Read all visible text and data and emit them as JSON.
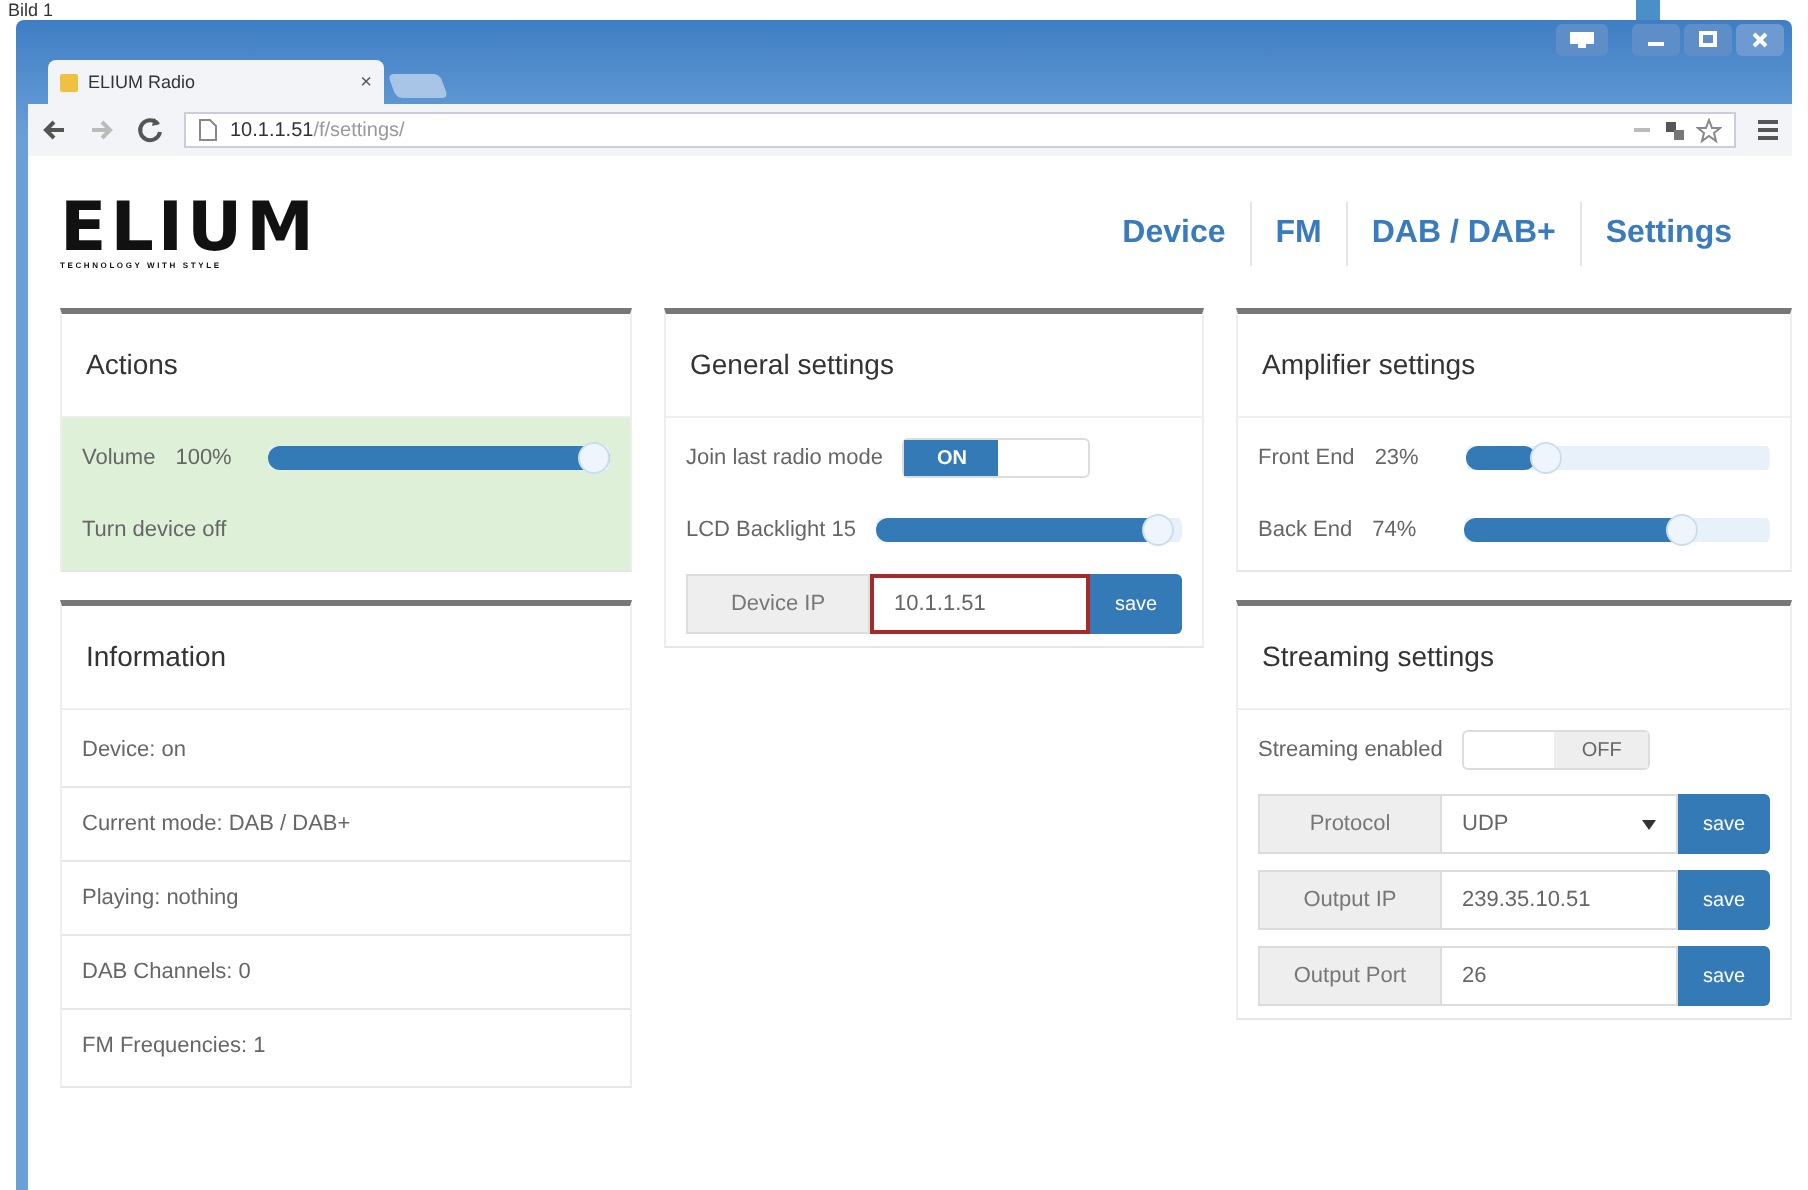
{
  "caption": "Bild 1",
  "browser": {
    "tab_title": "ELIUM Radio",
    "tab_close": "×",
    "url_host": "10.1.1.51",
    "url_path": "/f/settings/"
  },
  "header": {
    "logo": "ELIUM",
    "tagline": "TECHNOLOGY WITH STYLE",
    "nav": [
      "Device",
      "FM",
      "DAB / DAB+",
      "Settings"
    ]
  },
  "actions": {
    "title": "Actions",
    "rows": [
      {
        "kind": "slider",
        "label": "Volume",
        "reading": "100%",
        "level": 1.0
      },
      {
        "kind": "link",
        "label": "Turn device off"
      }
    ]
  },
  "information": {
    "title": "Information",
    "rows": [
      {
        "kind": "text",
        "label": "Device: on"
      },
      {
        "kind": "text",
        "label": "Current mode: DAB / DAB+"
      },
      {
        "kind": "text",
        "label": "Playing: nothing"
      },
      {
        "kind": "text",
        "label": "DAB Channels: 0"
      },
      {
        "kind": "text",
        "label": "FM Frequencies: 1"
      }
    ]
  },
  "general": {
    "title": "General settings",
    "rows": [
      {
        "kind": "toggle",
        "label": "Join last radio mode",
        "on": true,
        "state_text": "ON"
      },
      {
        "kind": "slider",
        "label": "LCD Backlight 15",
        "level": 0.97
      },
      {
        "kind": "input",
        "label": "Device IP",
        "value": "10.1.1.51",
        "button": "save",
        "highlighted": true
      }
    ]
  },
  "amplifier": {
    "title": "Amplifier settings",
    "rows": [
      {
        "kind": "slider",
        "label": "Front End",
        "reading": "23%",
        "level": 0.23
      },
      {
        "kind": "slider",
        "label": "Back End",
        "reading": "74%",
        "level": 0.74
      }
    ]
  },
  "streaming": {
    "title": "Streaming settings",
    "rows": [
      {
        "kind": "toggle",
        "label": "Streaming enabled",
        "on": false,
        "state_text": "OFF"
      },
      {
        "kind": "select",
        "label": "Protocol",
        "value": "UDP",
        "button": "save"
      },
      {
        "kind": "input",
        "label": "Output IP",
        "value": "239.35.10.51",
        "button": "save",
        "highlighted": false
      },
      {
        "kind": "input",
        "label": "Output Port",
        "value": "26",
        "button": "save",
        "highlighted": false
      }
    ]
  }
}
